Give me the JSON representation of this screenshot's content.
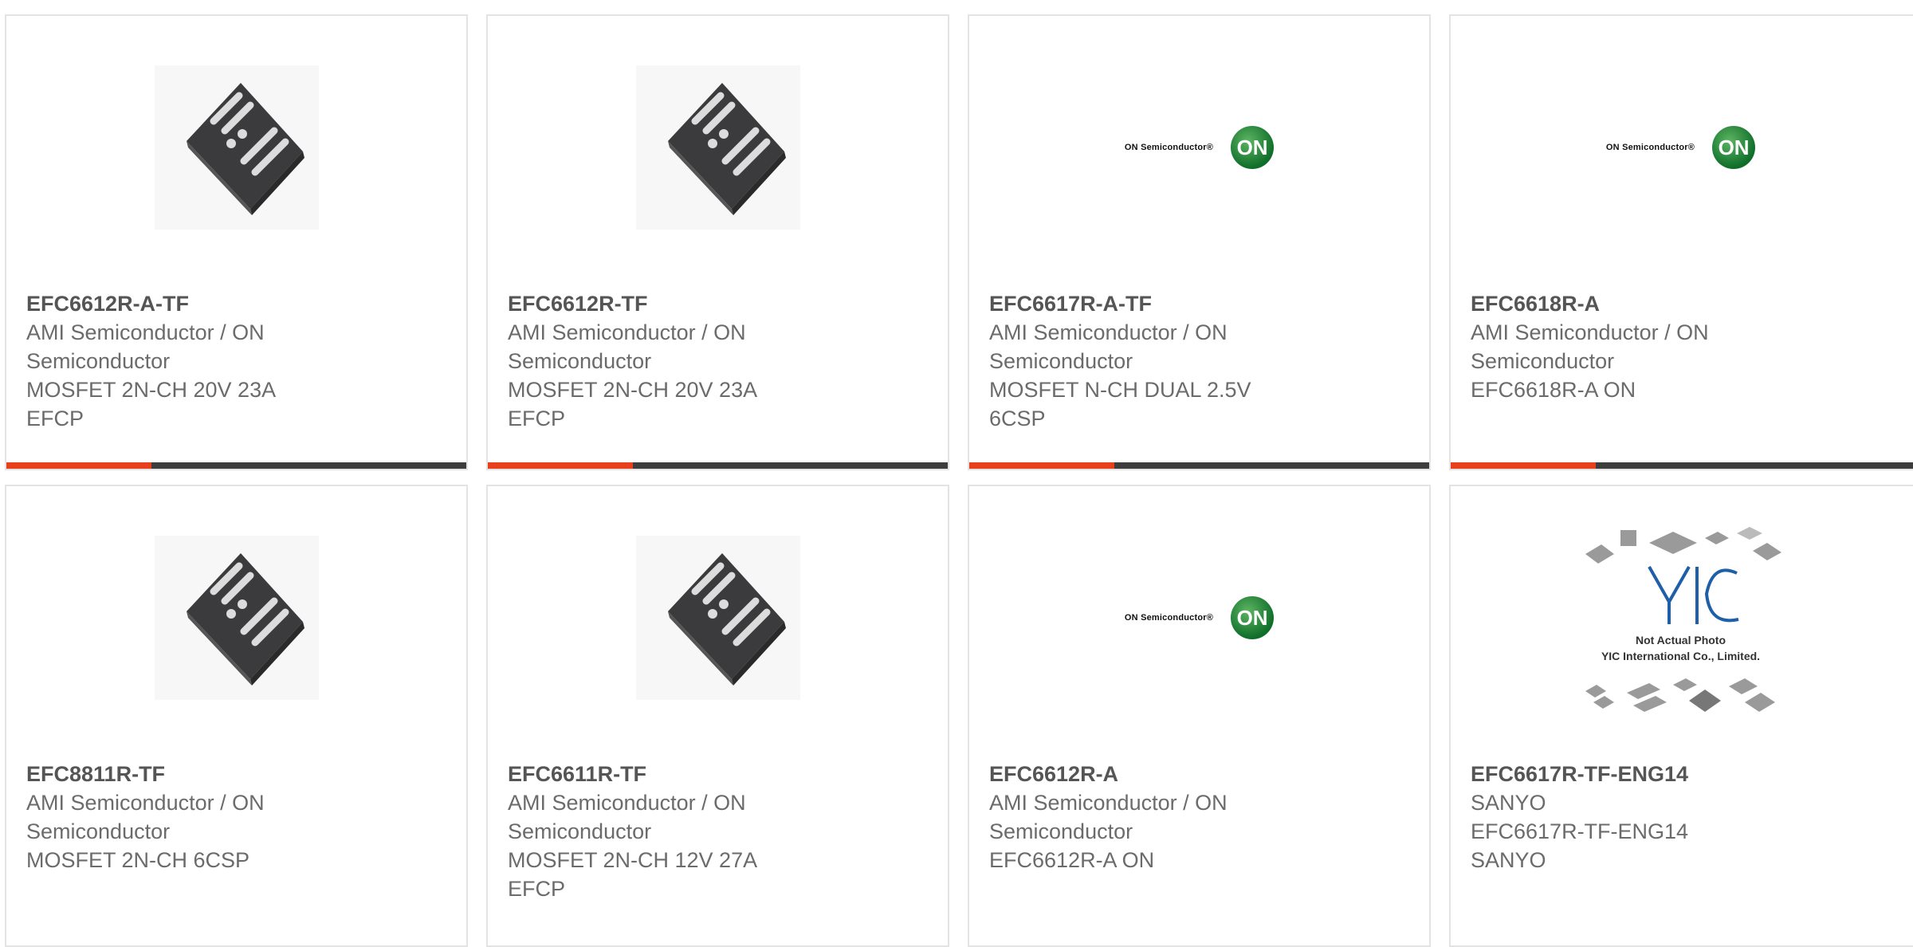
{
  "cards": [
    {
      "part": "EFC6612R-A-TF",
      "mfr_line1": "AMI Semiconductor / ON",
      "mfr_line2": "Semiconductor",
      "desc_line1": "MOSFET 2N-CH 20V 23A EFCP",
      "desc_line2": "",
      "image": "chip-icon"
    },
    {
      "part": "EFC6612R-TF",
      "mfr_line1": "AMI Semiconductor / ON",
      "mfr_line2": "Semiconductor",
      "desc_line1": "MOSFET 2N-CH 20V 23A EFCP",
      "desc_line2": "",
      "image": "chip-icon"
    },
    {
      "part": "EFC6617R-A-TF",
      "mfr_line1": "AMI Semiconductor / ON",
      "mfr_line2": "Semiconductor",
      "desc_line1": "MOSFET N-CH DUAL 2.5V",
      "desc_line2": "6CSP",
      "image": "on-semiconductor-logo"
    },
    {
      "part": "EFC6618R-A",
      "mfr_line1": "AMI Semiconductor / ON",
      "mfr_line2": "Semiconductor",
      "desc_line1": "EFC6618R-A ON",
      "desc_line2": "",
      "image": "on-semiconductor-logo"
    },
    {
      "part": "EFC8811R-TF",
      "mfr_line1": "AMI Semiconductor / ON",
      "mfr_line2": "Semiconductor",
      "desc_line1": "MOSFET 2N-CH 6CSP",
      "desc_line2": "",
      "image": "chip-icon"
    },
    {
      "part": "EFC6611R-TF",
      "mfr_line1": "AMI Semiconductor / ON",
      "mfr_line2": "Semiconductor",
      "desc_line1": "MOSFET 2N-CH 12V 27A EFCP",
      "desc_line2": "",
      "image": "chip-icon"
    },
    {
      "part": "EFC6612R-A",
      "mfr_line1": "AMI Semiconductor / ON",
      "mfr_line2": "Semiconductor",
      "desc_line1": "EFC6612R-A ON",
      "desc_line2": "",
      "image": "on-semiconductor-logo"
    },
    {
      "part": "EFC6617R-TF-ENG14",
      "mfr_line1": "SANYO",
      "mfr_line2": "",
      "desc_line1": "EFC6617R-TF-ENG14 SANYO",
      "desc_line2": "",
      "image": "yic-placeholder"
    }
  ],
  "logo": {
    "word": "ON Semiconductor®",
    "badge": "ON"
  },
  "yic": {
    "brand": "YIC",
    "caption1": "Not Actual Photo",
    "caption2": "YIC International Co., Limited."
  },
  "colors": {
    "accent": "#e8401c",
    "bar": "#3d3d3d",
    "border": "#e3e3e3",
    "text": "#6b6b6b"
  }
}
